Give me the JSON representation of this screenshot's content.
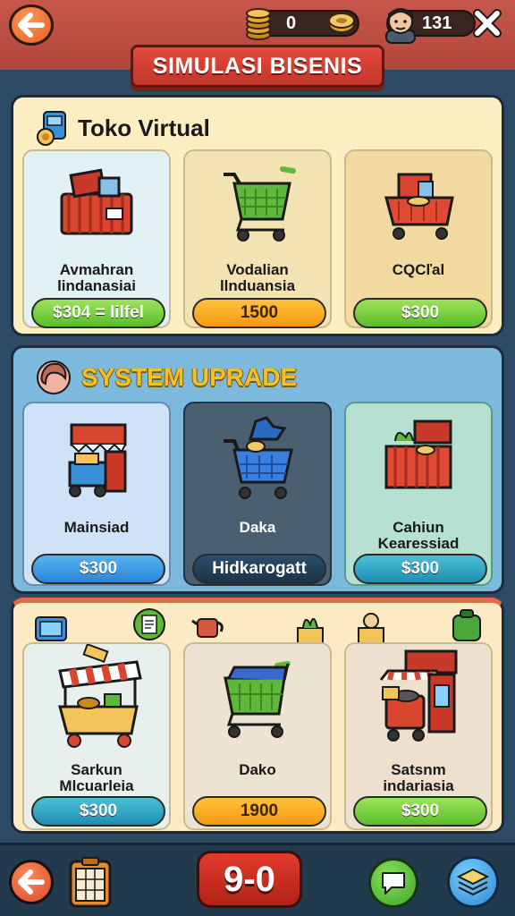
{
  "header": {
    "coins": "0",
    "gems": "131",
    "title": "SIMULASI BISENIS"
  },
  "section_store": {
    "title": "Toko Virtual",
    "cards": [
      {
        "name_line1": "Avmahran",
        "name_line2": "lindanasiai",
        "price": "$304 = lilfel",
        "button_color": "green"
      },
      {
        "name_line1": "Vodalian",
        "name_line2": "llnduansia",
        "price": "1500",
        "button_color": "orange"
      },
      {
        "name_line1": "CQCľal",
        "name_line2": "",
        "price": "$300",
        "button_color": "green"
      }
    ]
  },
  "section_upgrade": {
    "title": "SYSTEM UPRADE",
    "cards": [
      {
        "name_line1": "Mainsiad",
        "name_line2": "",
        "price": "$300",
        "button_color": "blue"
      },
      {
        "name_line1": "Daka",
        "name_line2": "",
        "price": "Hidkarogatt",
        "button_color": "dark"
      },
      {
        "name_line1": "Cahiun",
        "name_line2": "Kearessiad",
        "price": "$300",
        "button_color": "teal"
      }
    ]
  },
  "section_more": {
    "cards": [
      {
        "name_line1": "Sarkun",
        "name_line2": "Mlcuarleia",
        "price": "$300",
        "button_color": "teal"
      },
      {
        "name_line1": "Dako",
        "name_line2": "",
        "price": "1900",
        "button_color": "orange"
      },
      {
        "name_line1": "Satsnm",
        "name_line2": "indariasia",
        "price": "$300",
        "button_color": "green"
      }
    ]
  },
  "footer": {
    "score": "9-0"
  },
  "icons": {
    "back": "back-arrow-icon",
    "coins": "coin-stack-icon",
    "gem": "coin-icon",
    "avatar": "avatar-icon",
    "close": "close-icon",
    "calculator": "calculator-icon",
    "chat": "chat-bubble-icon",
    "layers": "layers-icon"
  }
}
